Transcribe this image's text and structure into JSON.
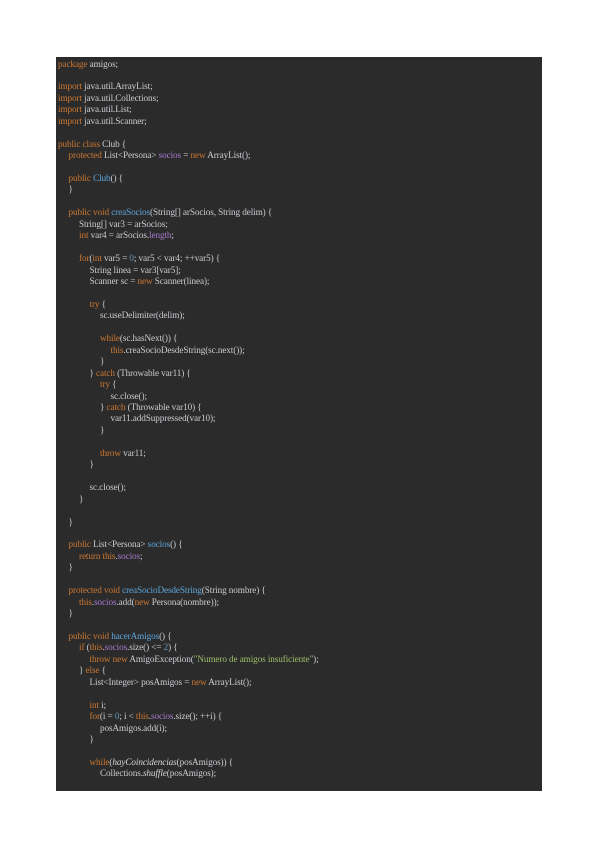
{
  "colors": {
    "background": "#2b2b2b",
    "plain": "#c9cdd2",
    "keyword": "#cc7832",
    "function": "#5ea6dd",
    "field": "#a77bd0",
    "number": "#6897bb",
    "string": "#9dbf6a"
  },
  "lines": [
    {
      "indent": 0,
      "tokens": [
        [
          "kw",
          "package"
        ],
        [
          "p",
          " amigos;"
        ]
      ]
    },
    {
      "indent": 0,
      "tokens": []
    },
    {
      "indent": 0,
      "tokens": [
        [
          "kw",
          "import"
        ],
        [
          "p",
          " java.util.ArrayList;"
        ]
      ]
    },
    {
      "indent": 0,
      "tokens": [
        [
          "kw",
          "import"
        ],
        [
          "p",
          " java.util.Collections;"
        ]
      ]
    },
    {
      "indent": 0,
      "tokens": [
        [
          "kw",
          "import"
        ],
        [
          "p",
          " java.util.List;"
        ]
      ]
    },
    {
      "indent": 0,
      "tokens": [
        [
          "kw",
          "import"
        ],
        [
          "p",
          " java.util.Scanner;"
        ]
      ]
    },
    {
      "indent": 0,
      "tokens": []
    },
    {
      "indent": 0,
      "tokens": [
        [
          "kw",
          "public class"
        ],
        [
          "p",
          " Club {"
        ]
      ]
    },
    {
      "indent": 1,
      "tokens": [
        [
          "kw",
          "protected"
        ],
        [
          "p",
          " List<Persona> "
        ],
        [
          "field",
          "socios"
        ],
        [
          "p",
          " = "
        ],
        [
          "kw",
          "new"
        ],
        [
          "p",
          " ArrayList();"
        ]
      ]
    },
    {
      "indent": 0,
      "tokens": []
    },
    {
      "indent": 1,
      "tokens": [
        [
          "kw",
          "public"
        ],
        [
          "p",
          " "
        ],
        [
          "fn",
          "Club"
        ],
        [
          "p",
          "() {"
        ]
      ]
    },
    {
      "indent": 1,
      "tokens": [
        [
          "p",
          "}"
        ]
      ]
    },
    {
      "indent": 0,
      "tokens": []
    },
    {
      "indent": 1,
      "tokens": [
        [
          "kw",
          "public void"
        ],
        [
          "p",
          " "
        ],
        [
          "fn",
          "creaSocios"
        ],
        [
          "p",
          "(String[] arSocios, String delim) {"
        ]
      ]
    },
    {
      "indent": 2,
      "tokens": [
        [
          "p",
          "String[] var3 = arSocios;"
        ]
      ]
    },
    {
      "indent": 2,
      "tokens": [
        [
          "kw",
          "int"
        ],
        [
          "p",
          " var4 = arSocios."
        ],
        [
          "field",
          "length"
        ],
        [
          "p",
          ";"
        ]
      ]
    },
    {
      "indent": 0,
      "tokens": []
    },
    {
      "indent": 2,
      "tokens": [
        [
          "kw",
          "for"
        ],
        [
          "p",
          "("
        ],
        [
          "kw",
          "int"
        ],
        [
          "p",
          " var5 = "
        ],
        [
          "num",
          "0"
        ],
        [
          "p",
          "; var5 < var4; ++var5) {"
        ]
      ]
    },
    {
      "indent": 3,
      "tokens": [
        [
          "p",
          "String linea = var3[var5];"
        ]
      ]
    },
    {
      "indent": 3,
      "tokens": [
        [
          "p",
          "Scanner sc = "
        ],
        [
          "kw",
          "new"
        ],
        [
          "p",
          " Scanner(linea);"
        ]
      ]
    },
    {
      "indent": 0,
      "tokens": []
    },
    {
      "indent": 3,
      "tokens": [
        [
          "kw",
          "try"
        ],
        [
          "p",
          " {"
        ]
      ]
    },
    {
      "indent": 4,
      "tokens": [
        [
          "p",
          "sc.useDelimiter(delim);"
        ]
      ]
    },
    {
      "indent": 0,
      "tokens": []
    },
    {
      "indent": 4,
      "tokens": [
        [
          "kw",
          "while"
        ],
        [
          "p",
          "(sc.hasNext()) {"
        ]
      ]
    },
    {
      "indent": 5,
      "tokens": [
        [
          "kw",
          "this"
        ],
        [
          "p",
          ".creaSocioDesdeString(sc.next());"
        ]
      ]
    },
    {
      "indent": 4,
      "tokens": [
        [
          "p",
          "}"
        ]
      ]
    },
    {
      "indent": 3,
      "tokens": [
        [
          "p",
          "} "
        ],
        [
          "kw",
          "catch"
        ],
        [
          "p",
          " (Throwable var11) {"
        ]
      ]
    },
    {
      "indent": 4,
      "tokens": [
        [
          "kw",
          "try"
        ],
        [
          "p",
          " {"
        ]
      ]
    },
    {
      "indent": 5,
      "tokens": [
        [
          "p",
          "sc.close();"
        ]
      ]
    },
    {
      "indent": 4,
      "tokens": [
        [
          "p",
          "} "
        ],
        [
          "kw",
          "catch"
        ],
        [
          "p",
          " (Throwable var10) {"
        ]
      ]
    },
    {
      "indent": 5,
      "tokens": [
        [
          "p",
          "var11.addSuppressed(var10);"
        ]
      ]
    },
    {
      "indent": 4,
      "tokens": [
        [
          "p",
          "}"
        ]
      ]
    },
    {
      "indent": 0,
      "tokens": []
    },
    {
      "indent": 4,
      "tokens": [
        [
          "kw",
          "throw"
        ],
        [
          "p",
          " var11;"
        ]
      ]
    },
    {
      "indent": 3,
      "tokens": [
        [
          "p",
          "}"
        ]
      ]
    },
    {
      "indent": 0,
      "tokens": []
    },
    {
      "indent": 3,
      "tokens": [
        [
          "p",
          "sc.close();"
        ]
      ]
    },
    {
      "indent": 2,
      "tokens": [
        [
          "p",
          "}"
        ]
      ]
    },
    {
      "indent": 0,
      "tokens": []
    },
    {
      "indent": 1,
      "tokens": [
        [
          "p",
          "}"
        ]
      ]
    },
    {
      "indent": 0,
      "tokens": []
    },
    {
      "indent": 1,
      "tokens": [
        [
          "kw",
          "public"
        ],
        [
          "p",
          " List<Persona> "
        ],
        [
          "fn",
          "socios"
        ],
        [
          "p",
          "() {"
        ]
      ]
    },
    {
      "indent": 2,
      "tokens": [
        [
          "kw",
          "return this"
        ],
        [
          "p",
          "."
        ],
        [
          "field",
          "socios"
        ],
        [
          "p",
          ";"
        ]
      ]
    },
    {
      "indent": 1,
      "tokens": [
        [
          "p",
          "}"
        ]
      ]
    },
    {
      "indent": 0,
      "tokens": []
    },
    {
      "indent": 1,
      "tokens": [
        [
          "kw",
          "protected void"
        ],
        [
          "p",
          " "
        ],
        [
          "fn",
          "creaSocioDesdeString"
        ],
        [
          "p",
          "(String nombre) {"
        ]
      ]
    },
    {
      "indent": 2,
      "tokens": [
        [
          "kw",
          "this"
        ],
        [
          "p",
          "."
        ],
        [
          "field",
          "socios"
        ],
        [
          "p",
          ".add("
        ],
        [
          "kw",
          "new"
        ],
        [
          "p",
          " Persona(nombre));"
        ]
      ]
    },
    {
      "indent": 1,
      "tokens": [
        [
          "p",
          "}"
        ]
      ]
    },
    {
      "indent": 0,
      "tokens": []
    },
    {
      "indent": 1,
      "tokens": [
        [
          "kw",
          "public void"
        ],
        [
          "p",
          " "
        ],
        [
          "fn",
          "hacerAmigos"
        ],
        [
          "p",
          "() {"
        ]
      ]
    },
    {
      "indent": 2,
      "tokens": [
        [
          "kw",
          "if"
        ],
        [
          "p",
          " ("
        ],
        [
          "kw",
          "this"
        ],
        [
          "p",
          "."
        ],
        [
          "field",
          "socios"
        ],
        [
          "p",
          ".size() <= "
        ],
        [
          "num",
          "2"
        ],
        [
          "p",
          ") {"
        ]
      ]
    },
    {
      "indent": 3,
      "tokens": [
        [
          "kw",
          "throw new"
        ],
        [
          "p",
          " AmigoException("
        ],
        [
          "str",
          "\"Numero de amigos insuficiente\""
        ],
        [
          "p",
          ");"
        ]
      ]
    },
    {
      "indent": 2,
      "tokens": [
        [
          "p",
          "} "
        ],
        [
          "kw",
          "else"
        ],
        [
          "p",
          " {"
        ]
      ]
    },
    {
      "indent": 3,
      "tokens": [
        [
          "p",
          "List<Integer> posAmigos = "
        ],
        [
          "kw",
          "new"
        ],
        [
          "p",
          " ArrayList();"
        ]
      ]
    },
    {
      "indent": 0,
      "tokens": []
    },
    {
      "indent": 3,
      "tokens": [
        [
          "kw",
          "int"
        ],
        [
          "p",
          " i;"
        ]
      ]
    },
    {
      "indent": 3,
      "tokens": [
        [
          "kw",
          "for"
        ],
        [
          "p",
          "(i = "
        ],
        [
          "num",
          "0"
        ],
        [
          "p",
          "; i < "
        ],
        [
          "kw",
          "this"
        ],
        [
          "p",
          "."
        ],
        [
          "field",
          "socios"
        ],
        [
          "p",
          ".size(); ++i) {"
        ]
      ]
    },
    {
      "indent": 4,
      "tokens": [
        [
          "p",
          "posAmigos.add(i);"
        ]
      ]
    },
    {
      "indent": 3,
      "tokens": [
        [
          "p",
          "}"
        ]
      ]
    },
    {
      "indent": 0,
      "tokens": []
    },
    {
      "indent": 3,
      "tokens": [
        [
          "kw",
          "while"
        ],
        [
          "p",
          "("
        ],
        [
          "it",
          "hayCoincidencias"
        ],
        [
          "p",
          "(posAmigos)) {"
        ]
      ]
    },
    {
      "indent": 4,
      "tokens": [
        [
          "p",
          "Collections."
        ],
        [
          "it",
          "shuffle"
        ],
        [
          "p",
          "(posAmigos);"
        ]
      ]
    }
  ]
}
